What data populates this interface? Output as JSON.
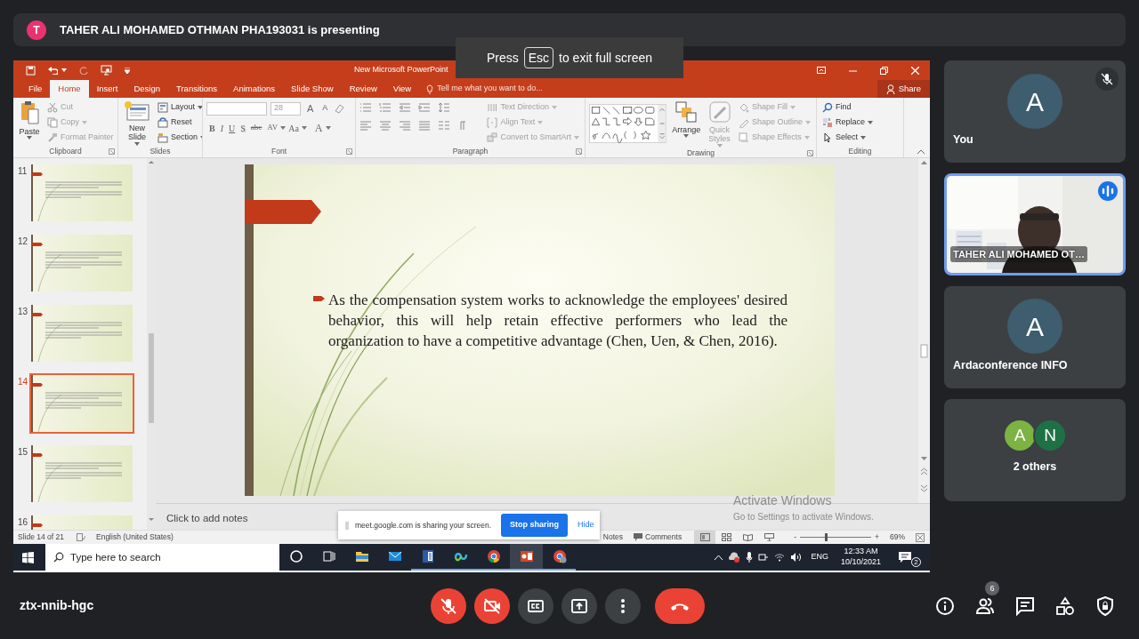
{
  "presenting": {
    "avatar": "T",
    "text": "TAHER ALI MOHAMED OTHMAN PHA193031 is presenting"
  },
  "fullscreen_hint": {
    "before": "Press",
    "key": "Esc",
    "after": "to exit full screen"
  },
  "powerpoint": {
    "title": "New Microsoft PowerPoint",
    "tabs": [
      {
        "label": "File",
        "selected": false
      },
      {
        "label": "Home",
        "selected": true
      },
      {
        "label": "Insert",
        "selected": false
      },
      {
        "label": "Design",
        "selected": false
      },
      {
        "label": "Transitions",
        "selected": false
      },
      {
        "label": "Animations",
        "selected": false
      },
      {
        "label": "Slide Show",
        "selected": false
      },
      {
        "label": "Review",
        "selected": false
      },
      {
        "label": "View",
        "selected": false
      }
    ],
    "tell_me": "Tell me what you want to do...",
    "share": "Share",
    "ribbon": [
      {
        "label": "Clipboard",
        "kind": "basic",
        "large": [
          {
            "label": "Paste",
            "disabled": false,
            "dropdown": true
          }
        ],
        "small": [
          {
            "label": "Cut",
            "disabled": true,
            "dropdown": false
          },
          {
            "label": "Copy",
            "disabled": true,
            "dropdown": true
          },
          {
            "label": "Format Painter",
            "disabled": true,
            "dropdown": false
          }
        ]
      },
      {
        "label": "Slides",
        "kind": "basic",
        "large": [
          {
            "label": "New Slide",
            "disabled": false,
            "dropdown": true
          }
        ],
        "small": [
          {
            "label": "Layout",
            "disabled": false,
            "dropdown": true
          },
          {
            "label": "Reset",
            "disabled": false,
            "dropdown": false
          },
          {
            "label": "Section",
            "disabled": false,
            "dropdown": true
          }
        ]
      },
      {
        "label": "Font",
        "kind": "font",
        "size": "28",
        "size_buttons": [
          "A",
          "A"
        ],
        "format_buttons": [
          "B",
          "I",
          "U",
          "S",
          "abc",
          "AV",
          "Aa",
          "A"
        ]
      },
      {
        "label": "Paragraph",
        "kind": "paragraph",
        "small": [
          {
            "label": "Text Direction",
            "disabled": true,
            "dropdown": true
          },
          {
            "label": "Align Text",
            "disabled": true,
            "dropdown": true
          },
          {
            "label": "Convert to SmartArt",
            "disabled": true,
            "dropdown": true
          }
        ]
      },
      {
        "label": "Drawing",
        "kind": "drawing",
        "large": [
          {
            "label": "Arrange",
            "disabled": false,
            "dropdown": true
          },
          {
            "label": "Quick Styles",
            "disabled": true,
            "dropdown": true
          }
        ],
        "small": [
          {
            "label": "Shape Fill",
            "disabled": true,
            "dropdown": true
          },
          {
            "label": "Shape Outline",
            "disabled": true,
            "dropdown": true
          },
          {
            "label": "Shape Effects",
            "disabled": true,
            "dropdown": true
          }
        ]
      },
      {
        "label": "Editing",
        "kind": "basic",
        "small": [
          {
            "label": "Find",
            "disabled": false,
            "dropdown": false
          },
          {
            "label": "Replace",
            "disabled": false,
            "dropdown": true
          },
          {
            "label": "Select",
            "disabled": false,
            "dropdown": true
          }
        ]
      }
    ],
    "thumbnails": [
      {
        "number": "11",
        "selected": false
      },
      {
        "number": "12",
        "selected": false
      },
      {
        "number": "13",
        "selected": false
      },
      {
        "number": "14",
        "selected": true
      },
      {
        "number": "15",
        "selected": false
      },
      {
        "number": "16",
        "selected": false
      }
    ],
    "slide": {
      "text": "As the compensation system works to acknowledge the employees' desired behavior, this will help retain effective performers who lead the organization to have a competitive advantage (Chen, Uen, & Chen, 2016)."
    },
    "notes_placeholder": "Click to add notes",
    "status": {
      "slide": "Slide 14 of 21",
      "language": "English (United States)",
      "notes": "Notes",
      "comments": "Comments",
      "views": [
        {
          "selected": true
        },
        {
          "selected": false
        },
        {
          "selected": false
        },
        {
          "selected": false
        }
      ],
      "zoom_out": "-",
      "zoom_slider": {
        "level": 0.36
      },
      "zoom_in": "+",
      "zoom": "69%"
    },
    "activation": {
      "title": "Activate Windows",
      "text": "Go to Settings to activate Windows."
    },
    "share_banner": {
      "text": "meet.google.com is sharing your screen.",
      "stop": "Stop sharing",
      "hide": "Hide"
    },
    "taskbar": {
      "search_placeholder": "Type here to search",
      "apps": [
        {
          "kind": "cortana",
          "running": false,
          "selected": false
        },
        {
          "kind": "task-view",
          "running": false,
          "selected": false
        },
        {
          "kind": "explorer",
          "running": false,
          "selected": false
        },
        {
          "kind": "mail",
          "running": false,
          "selected": false
        },
        {
          "kind": "word",
          "running": true,
          "selected": false
        },
        {
          "kind": "webex",
          "running": true,
          "selected": false
        },
        {
          "kind": "chrome",
          "running": true,
          "selected": false
        },
        {
          "kind": "powerpoint",
          "running": true,
          "selected": true
        },
        {
          "kind": "chrome-profile",
          "running": true,
          "selected": false
        }
      ],
      "language": "ENG",
      "time": "12:33 AM",
      "date": "10/10/2021",
      "notifications": "2"
    }
  },
  "participants": [
    {
      "kind": "self",
      "avatar": "A",
      "name": "You",
      "muted": true
    },
    {
      "kind": "video",
      "name": "TAHER ALI MOHAMED OT…",
      "speaking": true
    },
    {
      "kind": "avatar",
      "avatar": "A",
      "name": "Ardaconference INFO"
    },
    {
      "kind": "group",
      "avatars": [
        {
          "letter": "A",
          "color": "#7cb342"
        },
        {
          "letter": "N",
          "color": "#1e7145"
        }
      ],
      "name": "2 others"
    }
  ],
  "meeting_code": "ztx-nnib-hgc",
  "call_controls": [
    {
      "kind": "mic",
      "on": false
    },
    {
      "kind": "camera",
      "on": false
    },
    {
      "kind": "captions",
      "on": false
    },
    {
      "kind": "present"
    },
    {
      "kind": "more"
    },
    {
      "kind": "leave"
    }
  ],
  "meeting_tools": [
    {
      "kind": "info"
    },
    {
      "kind": "people",
      "badge": "6"
    },
    {
      "kind": "chat"
    },
    {
      "kind": "activities"
    },
    {
      "kind": "safety"
    }
  ]
}
